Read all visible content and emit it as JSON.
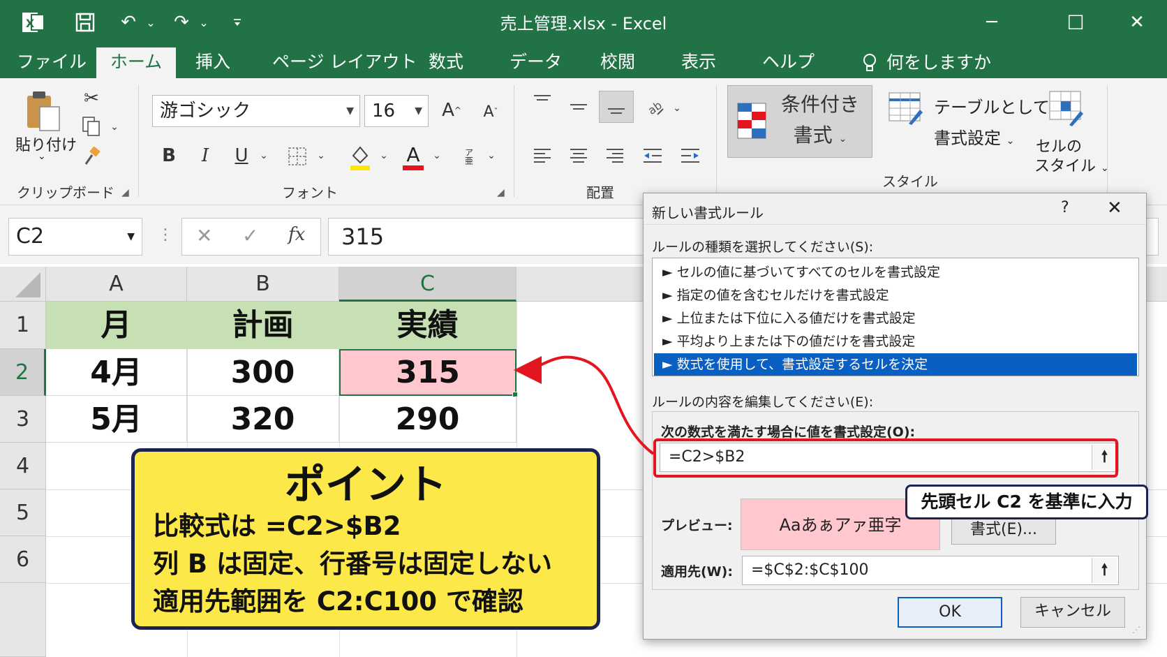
{
  "titlebar": {
    "title": "売上管理.xlsx  -  Excel",
    "qa_redo": "↷",
    "qa_undo": "↶",
    "qa_more": "⌄",
    "min": "─",
    "max": "☐",
    "close": "✕",
    "app_icon": "X"
  },
  "menu": {
    "tabs": [
      "ファイル",
      "ホーム",
      "挿入",
      "ページ レイアウト",
      "数式",
      "データ",
      "校閲",
      "表示",
      "ヘルプ"
    ],
    "tell_me": "何をしますか"
  },
  "ribbon": {
    "paste": "貼り付け",
    "clipboard_label": "クリップボード",
    "font_name": "游ゴシック",
    "font_size": "16",
    "font_label": "フォント",
    "align_label": "配置",
    "conditional_line1": "条件付き",
    "conditional_line2": "書式",
    "table_line1": "テーブルとして",
    "table_line2": "書式設定",
    "cellstyle_line1": "セルの",
    "cellstyle_line2": "スタイル",
    "style_label": "スタイル",
    "bold": "B",
    "italic": "I",
    "underline": "U",
    "font_color_glyph": "A",
    "grow_font": "A",
    "shrink_font": "A"
  },
  "formula_bar": {
    "name_box": "C2",
    "cancel": "✕",
    "enter": "✓",
    "fx": "fx",
    "value": "315"
  },
  "grid": {
    "columns": [
      "A",
      "B",
      "C"
    ],
    "rows": [
      "1",
      "2",
      "3",
      "4",
      "5",
      "6"
    ],
    "cells": [
      [
        "月",
        "計画",
        "実績"
      ],
      [
        "4月",
        "300",
        "315"
      ],
      [
        "5月",
        "320",
        "290"
      ]
    ]
  },
  "point": {
    "title": "ポイント",
    "lines": [
      "比較式は  =C2>$B2",
      "列 B は固定、行番号は固定しない",
      "適用先範囲を C2:C100 で確認"
    ]
  },
  "dialog": {
    "title": "新しい書式ルール",
    "help": "?",
    "close": "✕",
    "select_label": "ルールの種類を選択してください(S):",
    "rules": [
      "► セルの値に基づいてすべてのセルを書式設定",
      "► 指定の値を含むセルだけを書式設定",
      "► 上位または下位に入る値だけを書式設定",
      "► 平均より上または下の値だけを書式設定",
      "► 数式を使用して、書式設定するセルを決定"
    ],
    "edit_label": "ルールの内容を編集してください(E):",
    "formula_label": "次の数式を満たす場合に値を書式設定(O):",
    "formula_value": "=C2>$B2",
    "preview_label": "プレビュー:",
    "preview_text": "Aaあぁアァ亜字",
    "format_button": "書式(E)...",
    "applies_label": "適用先(W):",
    "applies_value": "=$C$2:$C$100",
    "ok": "OK",
    "cancel": "キャンセル"
  },
  "annotation": {
    "text": "先頭セル C2 を基準に入力"
  },
  "colors": {
    "excel_green": "#217346",
    "header_fill": "#c6e0b4",
    "highlight_fill": "#ffc7ce",
    "callout_fill": "#fde84a",
    "arrow_red": "#e3151e",
    "selection_blue": "#0a5fc2"
  }
}
